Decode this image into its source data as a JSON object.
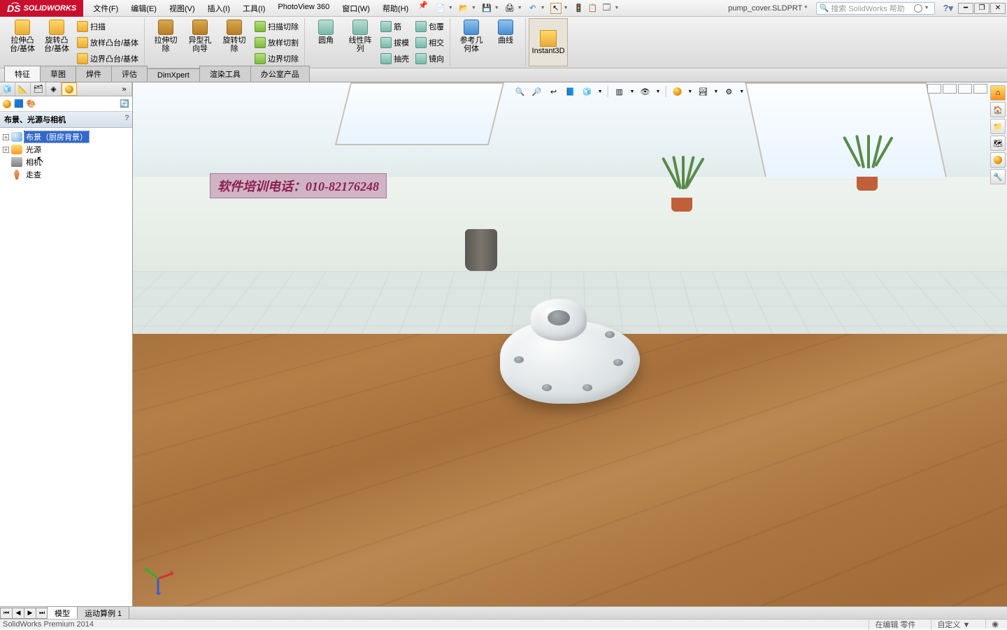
{
  "app": {
    "name": "SOLIDWORKS"
  },
  "menu": {
    "file": "文件(F)",
    "edit": "编辑(E)",
    "view": "视图(V)",
    "insert": "插入(I)",
    "tools": "工具(I)",
    "photoview": "PhotoView 360",
    "window": "窗口(W)",
    "help": "帮助(H)"
  },
  "doc": {
    "name": "pump_cover.SLDPRT *"
  },
  "search": {
    "placeholder": "搜索 SolidWorks 帮助"
  },
  "ribbon": {
    "g1": {
      "boss_extrude": "拉伸凸\n台/基体",
      "boss_revolve": "旋转凸\n台/基体",
      "sweep": "扫描",
      "loft": "放样凸台/基体",
      "boundary": "边界凸台/基体"
    },
    "g2": {
      "cut_extrude": "拉伸切\n除",
      "hole": "异型孔\n向导",
      "cut_revolve": "旋转切\n除",
      "cut_sweep": "扫描切除",
      "cut_loft": "放样切割",
      "cut_boundary": "边界切除"
    },
    "g3": {
      "fillet": "圆角",
      "pattern": "线性阵\n列",
      "rib": "筋",
      "draft": "拔模",
      "shell": "抽壳",
      "wrap": "包覆",
      "intersect": "相交",
      "mirror": "镜向"
    },
    "g4": {
      "refgeo": "参考几\n何体",
      "curve": "曲线"
    },
    "instant": "Instant3D"
  },
  "cmdtabs": {
    "t1": "特征",
    "t2": "草图",
    "t3": "焊件",
    "t4": "评估",
    "t5": "DimXpert",
    "t6": "渲染工具",
    "t7": "办公室产品"
  },
  "fm": {
    "title": "布景、光源与相机",
    "scene": "布景（厨房背景）",
    "light": "光源",
    "camera": "相机",
    "walk": "走查"
  },
  "overlay": {
    "text": "软件培训电话：010-82176248"
  },
  "bottom": {
    "model": "模型",
    "motion": "运动算例 1"
  },
  "status": {
    "left": "SolidWorks Premium 2014",
    "editing": "在编辑 零件",
    "custom": "自定义"
  }
}
